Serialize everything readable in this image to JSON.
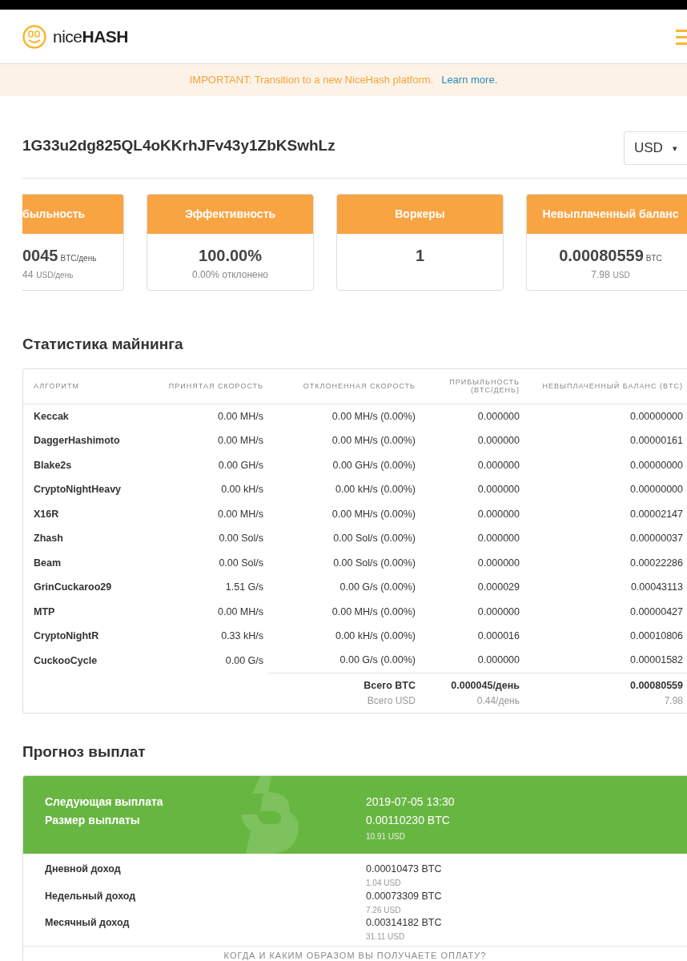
{
  "header": {
    "logo_text_light": "nice",
    "logo_text_bold": "HASH"
  },
  "banner": {
    "text": "IMPORTANT: Transition to a new NiceHash platform.",
    "link": "Learn more."
  },
  "address": "1G33u2dg825QL4oKKrhJFv43y1ZbKSwhLz",
  "currency": {
    "value": "USD",
    "caret": "▾"
  },
  "cards": [
    {
      "title": "быльность",
      "value": "0045",
      "unit": "BTC/день",
      "sub": "44",
      "sub_unit": "USD/день",
      "cut": true
    },
    {
      "title": "Эффективность",
      "value": "100.00%",
      "sub": "0.00% отклонено",
      "cut": false
    },
    {
      "title": "Воркеры",
      "value": "1",
      "cut": false
    },
    {
      "title": "Невыплаченный баланс",
      "value": "0.00080559",
      "unit": "BTC",
      "sub": "7.98",
      "sub_unit": "USD",
      "cut": false
    }
  ],
  "mining": {
    "title": "Статистика майнинга",
    "columns": [
      "АЛГОРИТМ",
      "ПРИНЯТАЯ СКОРОСТЬ",
      "ОТКЛОНЕННАЯ СКОРОСТЬ",
      "ПРИБЫЛЬНОСТЬ (BTC/ДЕНЬ)",
      "НЕВЫПЛАЧЕННЫЙ БАЛАНС (BTC)"
    ],
    "rows": [
      [
        "Keccak",
        "0.00 MH/s",
        "0.00 MH/s (0.00%)",
        "0.000000",
        "0.00000000"
      ],
      [
        "DaggerHashimoto",
        "0.00 MH/s",
        "0.00 MH/s (0.00%)",
        "0.000000",
        "0.00000161"
      ],
      [
        "Blake2s",
        "0.00 GH/s",
        "0.00 GH/s (0.00%)",
        "0.000000",
        "0.00000000"
      ],
      [
        "CryptoNightHeavy",
        "0.00 kH/s",
        "0.00 kH/s (0.00%)",
        "0.000000",
        "0.00000000"
      ],
      [
        "X16R",
        "0.00 MH/s",
        "0.00 MH/s (0.00%)",
        "0.000000",
        "0.00002147"
      ],
      [
        "Zhash",
        "0.00 Sol/s",
        "0.00 Sol/s (0.00%)",
        "0.000000",
        "0.00000037"
      ],
      [
        "Beam",
        "0.00 Sol/s",
        "0.00 Sol/s (0.00%)",
        "0.000000",
        "0.00022286"
      ],
      [
        "GrinCuckaroo29",
        "1.51 G/s",
        "0.00 G/s (0.00%)",
        "0.000029",
        "0.00043113"
      ],
      [
        "MTP",
        "0.00 MH/s",
        "0.00 MH/s (0.00%)",
        "0.000000",
        "0.00000427"
      ],
      [
        "CryptoNightR",
        "0.33 kH/s",
        "0.00 kH/s (0.00%)",
        "0.000016",
        "0.00010806"
      ],
      [
        "CuckooCycle",
        "0.00 G/s",
        "0.00 G/s (0.00%)",
        "0.000000",
        "0.00001582"
      ]
    ],
    "totals": [
      {
        "label": "Всего BTC",
        "profit": "0.000045/день",
        "balance": "0.00080559",
        "strong": true
      },
      {
        "label": "Всего USD",
        "profit": "0.44/день",
        "balance": "7.98",
        "strong": false
      }
    ]
  },
  "forecast": {
    "title": "Прогноз выплат",
    "next_label": "Следующая выплата",
    "next_value": "2019-07-05 13:30",
    "size_label": "Размер выплаты",
    "size_value": "0.00110230 BTC",
    "size_usd": "10.91 USD",
    "rows": [
      {
        "label": "Дневной доход",
        "btc": "0.00010473 BTC",
        "usd": "1.04 USD"
      },
      {
        "label": "Недельный доход",
        "btc": "0.00073309 BTC",
        "usd": "7.26 USD"
      },
      {
        "label": "Месячный доход",
        "btc": "0.00314182 BTC",
        "usd": "31.11 USD"
      }
    ],
    "footer_link": "КОГДА И КАКИМ ОБРАЗОМ ВЫ ПОЛУЧАЕТЕ ОПЛАТУ?"
  }
}
